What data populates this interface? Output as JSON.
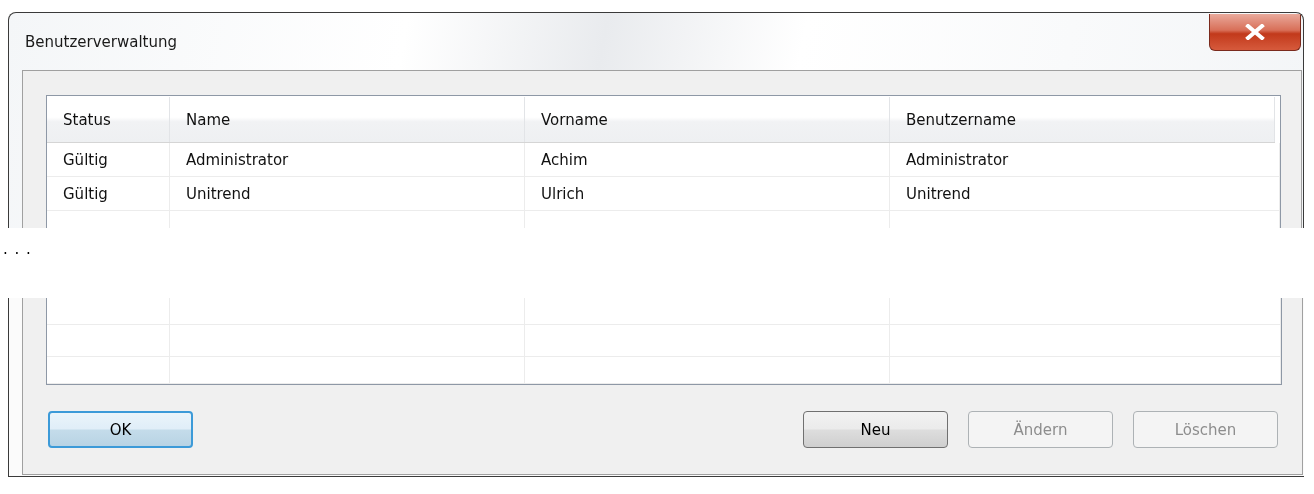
{
  "window": {
    "title": "Benutzerverwaltung"
  },
  "table": {
    "columns": [
      "Status",
      "Name",
      "Vorname",
      "Benutzername"
    ],
    "rows": [
      {
        "cells": [
          "Gültig",
          "Administrator",
          "Achim",
          "Administrator"
        ]
      },
      {
        "cells": [
          "Gültig",
          "Unitrend",
          "Ulrich",
          "Unitrend"
        ]
      }
    ]
  },
  "omission_marker": ". . .",
  "buttons": [
    {
      "label": "OK",
      "default": true,
      "disabled": false
    },
    {
      "label": "Neu",
      "default": false,
      "disabled": false
    },
    {
      "label": "Ändern",
      "default": false,
      "disabled": true
    },
    {
      "label": "Löschen",
      "default": false,
      "disabled": true
    }
  ]
}
